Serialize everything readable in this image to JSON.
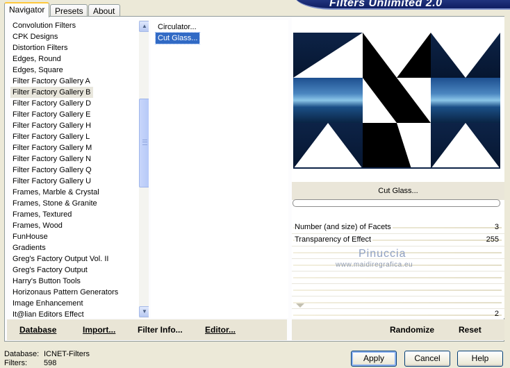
{
  "banner": {
    "title": "Filters Unlimited 2.0"
  },
  "tabs": [
    "Navigator",
    "Presets",
    "About"
  ],
  "categories": [
    "Convolution Filters",
    "CPK Designs",
    "Distortion Filters",
    "Edges, Round",
    "Edges, Square",
    "Filter Factory Gallery A",
    "Filter Factory Gallery B",
    "Filter Factory Gallery D",
    "Filter Factory Gallery E",
    "Filter Factory Gallery H",
    "Filter Factory Gallery L",
    "Filter Factory Gallery M",
    "Filter Factory Gallery N",
    "Filter Factory Gallery Q",
    "Filter Factory Gallery U",
    "Frames, Marble & Crystal",
    "Frames, Stone & Granite",
    "Frames, Textured",
    "Frames, Wood",
    "FunHouse",
    "Gradients",
    "Greg's Factory Output Vol. II",
    "Greg's Factory Output",
    "Harry's Button Tools",
    "Horizonaus Pattern Generators",
    "Image Enhancement",
    "It@lian Editors Effect"
  ],
  "selected_category": "Filter Factory Gallery B",
  "filters": [
    "Circulator...",
    "Cut Glass..."
  ],
  "selected_filter": "Cut Glass...",
  "preview": {
    "filter_name": "Cut Glass..."
  },
  "parameters": [
    {
      "name": "Number (and size) of Facets",
      "value": "3"
    },
    {
      "name": "Transparency of Effect",
      "value": "255"
    }
  ],
  "extra_value": "2",
  "watermark": {
    "title": "Pinuccia",
    "url": "www.maidiregrafica.eu"
  },
  "left_buttons": {
    "database": "Database",
    "import": "Import...",
    "filter_info": "Filter Info...",
    "editor": "Editor..."
  },
  "right_buttons": {
    "randomize": "Randomize",
    "reset": "Reset"
  },
  "status": {
    "database_label": "Database:",
    "database_value": "ICNET-Filters",
    "filters_label": "Filters:",
    "filters_value": "598"
  },
  "dialog_buttons": {
    "apply": "Apply",
    "cancel": "Cancel",
    "help": "Help"
  }
}
